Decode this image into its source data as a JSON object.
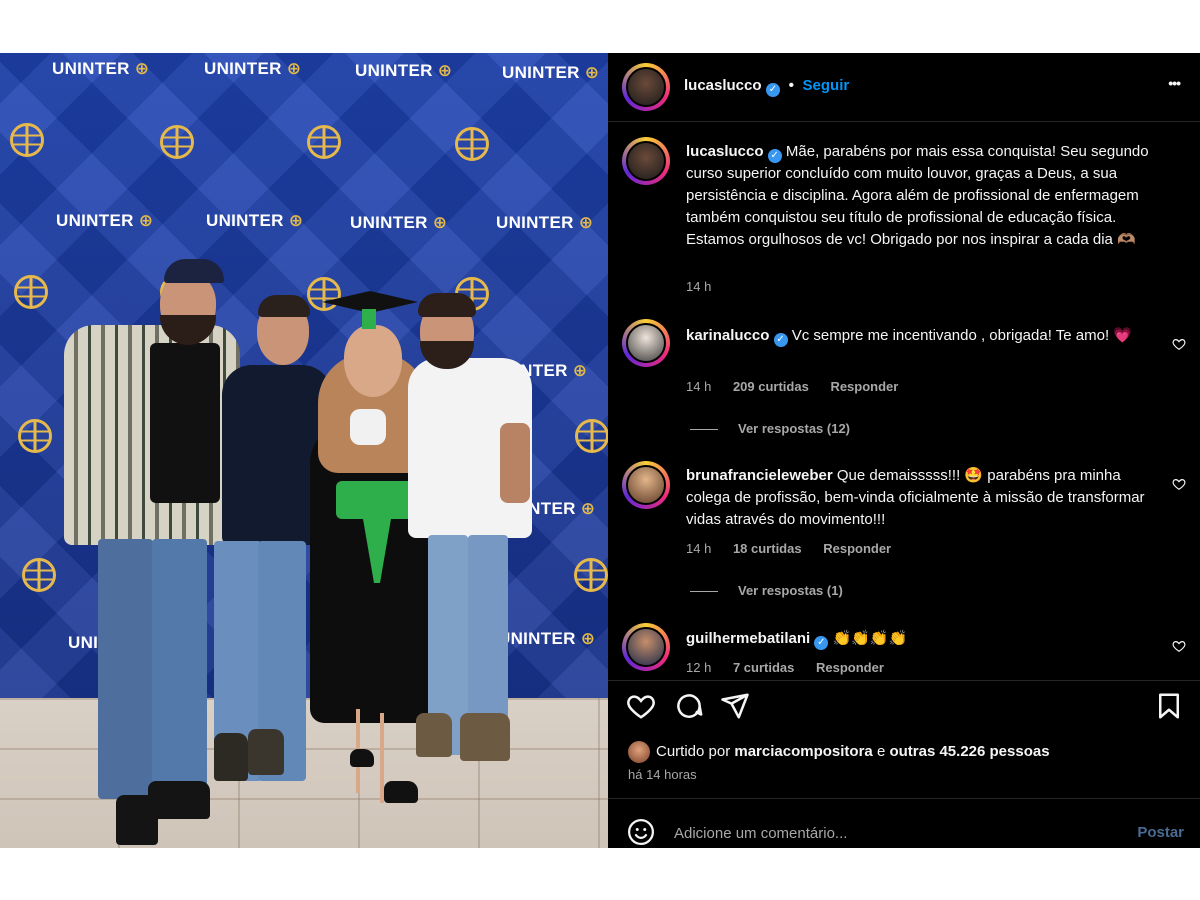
{
  "post": {
    "author": "lucaslucco",
    "follow_label": "Seguir",
    "separator": "•",
    "more_label": "•••"
  },
  "photo": {
    "brand_text": "UNINTER"
  },
  "caption": {
    "author": "lucaslucco",
    "text": "Mãe, parabéns por mais essa conquista! Seu segundo curso superior concluído com muito louvor, graças a Deus, a sua persistência e disciplina. Agora além de profissional de enfermagem também conquistou seu título de profissional de educação física. Estamos orgulhosos de vc! Obrigado por nos inspirar a cada dia 🫶🏽",
    "time": "14 h"
  },
  "comments": [
    {
      "author": "karinalucco",
      "verified": true,
      "text": "Vc sempre me incentivando , obrigada! Te amo! 💗",
      "time": "14 h",
      "likes": "209 curtidas",
      "reply_label": "Responder",
      "view_replies": "Ver respostas (12)"
    },
    {
      "author": "brunafrancieleweber",
      "verified": false,
      "text": "Que demaisssss!!! 🤩 parabéns pra minha colega de profissão, bem-vinda oficialmente à missão de transformar vidas através do movimento!!!",
      "time": "14 h",
      "likes": "18 curtidas",
      "reply_label": "Responder",
      "view_replies": "Ver respostas (1)"
    },
    {
      "author": "guilhermebatilani",
      "verified": true,
      "text": "👏👏👏👏",
      "time": "12 h",
      "likes": "7 curtidas",
      "reply_label": "Responder"
    }
  ],
  "likes_bar": {
    "prefix": "Curtido por",
    "liker": "marciacompositora",
    "connector": "e",
    "others": "outras 45.226 pessoas",
    "posted": "há 14 horas"
  },
  "composer": {
    "placeholder": "Adicione um comentário...",
    "post_label": "Postar"
  },
  "colors": {
    "accent": "#0095f6",
    "verified": "#3897f0",
    "background": "#000000",
    "secondary_text": "#a8a8a8"
  },
  "icons": [
    "heart-icon",
    "comment-icon",
    "share-icon",
    "bookmark-icon",
    "emoji-icon",
    "more-options-icon",
    "verified-badge-icon"
  ]
}
